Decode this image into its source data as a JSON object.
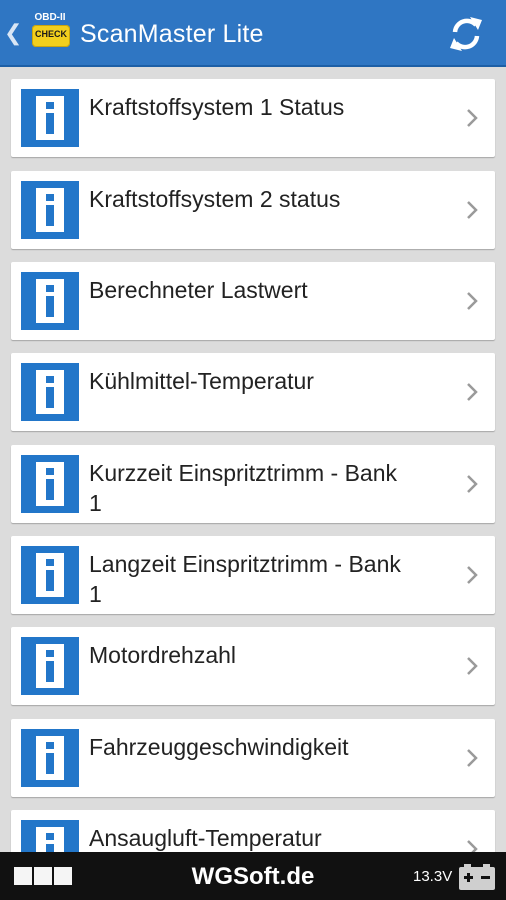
{
  "header": {
    "title": "ScanMaster Lite",
    "logo_top": "OBD-II",
    "logo_label": "CHECK",
    "back_glyph": "❮"
  },
  "icons": {
    "refresh": "refresh-icon",
    "info": "info-icon",
    "chevron": "chevron-right-icon",
    "battery": "battery-icon"
  },
  "colors": {
    "appbar": "#2f76c3",
    "info_icon": "#2276c9",
    "background": "#dcdcdc",
    "bottombar": "#111111"
  },
  "items": [
    {
      "label": "Kraftstoffsystem 1 Status"
    },
    {
      "label": "Kraftstoffsystem 2 status"
    },
    {
      "label": "Berechneter Lastwert"
    },
    {
      "label": "Kühlmittel-Temperatur"
    },
    {
      "label": "Kurzzeit Einspritztrimm - Bank 1"
    },
    {
      "label": "Langzeit Einspritztrimm - Bank 1"
    },
    {
      "label": "Motordrehzahl"
    },
    {
      "label": "Fahrzeuggeschwindigkeit"
    },
    {
      "label": "Ansaugluft-Temperatur"
    }
  ],
  "footer": {
    "brand": "WGSoft.de",
    "voltage": "13.3V"
  }
}
